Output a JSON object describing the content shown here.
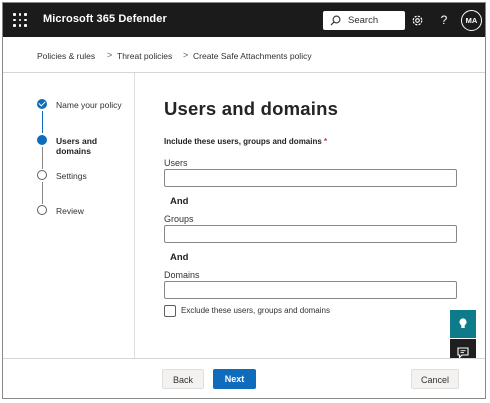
{
  "app": {
    "title": "Microsoft 365 Defender",
    "search_placeholder": "Search",
    "help_glyph": "?",
    "avatar_initials": "MA"
  },
  "icons": {
    "launcher": "app-launcher-icon",
    "search": "search-icon",
    "settings": "settings-icon",
    "help": "help-icon",
    "feedback": "lightbulb-icon",
    "chat": "chat-icon"
  },
  "breadcrumb": {
    "items": [
      "Policies & rules",
      "Threat policies",
      "Create Safe Attachments policy"
    ],
    "separator": ">"
  },
  "steps": [
    {
      "label": "Name your policy",
      "state": "done"
    },
    {
      "label": "Users and domains",
      "state": "current"
    },
    {
      "label": "Settings",
      "state": "todo"
    },
    {
      "label": "Review",
      "state": "todo"
    }
  ],
  "main": {
    "title": "Users and domains",
    "section_label": "Include these users, groups and domains",
    "required_mark": "*",
    "fields": [
      {
        "label": "Users",
        "value": ""
      },
      {
        "label": "Groups",
        "value": ""
      },
      {
        "label": "Domains",
        "value": ""
      }
    ],
    "and_label": "And",
    "exclude_label": "Exclude these users, groups and domains",
    "exclude_checked": false
  },
  "footer": {
    "back_label": "Back",
    "next_label": "Next",
    "cancel_label": "Cancel"
  },
  "colors": {
    "topbar": "#1b1b1b",
    "accent": "#0f6cbd",
    "feedback_button": "#0e7b8a",
    "chat_button": "#1f1f1f"
  }
}
